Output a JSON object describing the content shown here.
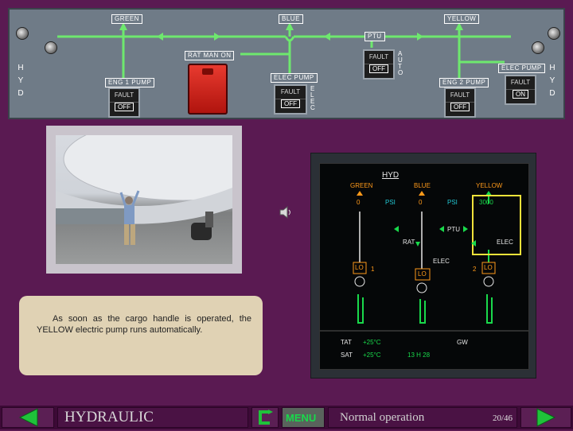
{
  "overhead_panel": {
    "system_labels": {
      "green": "GREEN",
      "blue": "BLUE",
      "yellow": "YELLOW"
    },
    "side_label_letters": [
      "H",
      "Y",
      "D"
    ],
    "rat_label": "RAT MAN ON",
    "ptu": {
      "label": "PTU",
      "fault": "FAULT",
      "off": "OFF",
      "auto_letters": [
        "A",
        "U",
        "T",
        "O"
      ]
    },
    "eng1_pump": {
      "label": "ENG 1 PUMP",
      "fault": "FAULT",
      "off": "OFF"
    },
    "elec_pump_blue": {
      "label": "ELEC PUMP",
      "fault": "FAULT",
      "off": "OFF",
      "elec_letters": [
        "E",
        "L",
        "E",
        "C"
      ]
    },
    "eng2_pump": {
      "label": "ENG 2 PUMP",
      "fault": "FAULT",
      "off": "OFF"
    },
    "elec_pump_yellow": {
      "label": "ELEC PUMP",
      "fault": "FAULT",
      "on": "ON"
    }
  },
  "note": {
    "text": "As soon as the cargo handle is operated, the YELLOW electric pump runs automatically."
  },
  "ecam": {
    "title": "HYD",
    "systems": {
      "green": "GREEN",
      "blue": "BLUE",
      "yellow": "YELLOW"
    },
    "pressures": {
      "green_zero": "0",
      "blue_zero": "0",
      "yellow_value": "3000",
      "psi": "PSI"
    },
    "ptu": "PTU",
    "rat": "RAT",
    "elec_yellow": "ELEC",
    "elec_blue": "ELEC",
    "engine_nums": [
      "1",
      "2"
    ],
    "lo": "LO",
    "tat_label": "TAT",
    "tat_value": "+25°C",
    "sat_label": "SAT",
    "sat_value": "+25°C",
    "time": "13 H 28",
    "gw": "GW"
  },
  "speaker_icon": "speaker-icon",
  "bottom_bar": {
    "section": "HYDRAULIC",
    "menu": "MENU",
    "status": "Normal operation",
    "page": "20/46"
  },
  "colors": {
    "background": "#5a1a52",
    "panel": "#6f7b87",
    "line_green": "#6ee86e",
    "ecam_amber": "#ff9a1a",
    "ecam_green": "#19d94b"
  }
}
